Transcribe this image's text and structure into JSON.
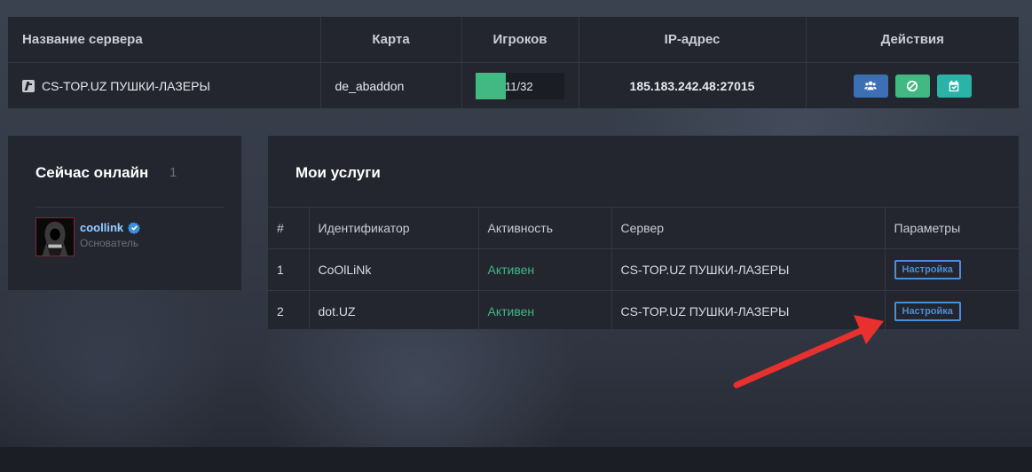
{
  "colors": {
    "accent_green": "#42b883",
    "accent_blue": "#4a8fd9",
    "panel": "#23252f",
    "btn_users": "#3d6fb4",
    "btn_ban": "#42b883",
    "btn_calendar": "#2ab3a6"
  },
  "server_table": {
    "columns": [
      "Название сервера",
      "Карта",
      "Игроков",
      "IP-адрес",
      "Действия"
    ],
    "row": {
      "icon": "counter-strike-game-icon",
      "name": "CS-TOP.UZ ПУШКИ-ЛАЗЕРЫ",
      "map": "de_abaddon",
      "players_text": "11/32",
      "players_current": 11,
      "players_max": 32,
      "ip": "185.183.242.48:27015",
      "actions": [
        {
          "icon": "users-icon"
        },
        {
          "icon": "ban-icon"
        },
        {
          "icon": "calendar-check-icon"
        }
      ]
    }
  },
  "online": {
    "title": "Сейчас онлайн",
    "count": "1",
    "users": [
      {
        "name": "coollink",
        "role": "Основатель",
        "verified": true
      }
    ]
  },
  "services": {
    "title": "Мои услуги",
    "columns": [
      "#",
      "Идентификатор",
      "Активность",
      "Сервер",
      "Параметры"
    ],
    "rows": [
      {
        "num": "1",
        "identifier": "CoOlLiNk",
        "status": "Активен",
        "server": "CS-TOP.UZ ПУШКИ-ЛАЗЕРЫ",
        "action": "Настройка"
      },
      {
        "num": "2",
        "identifier": "dot.UZ",
        "status": "Активен",
        "server": "CS-TOP.UZ ПУШКИ-ЛАЗЕРЫ",
        "action": "Настройка"
      }
    ]
  }
}
